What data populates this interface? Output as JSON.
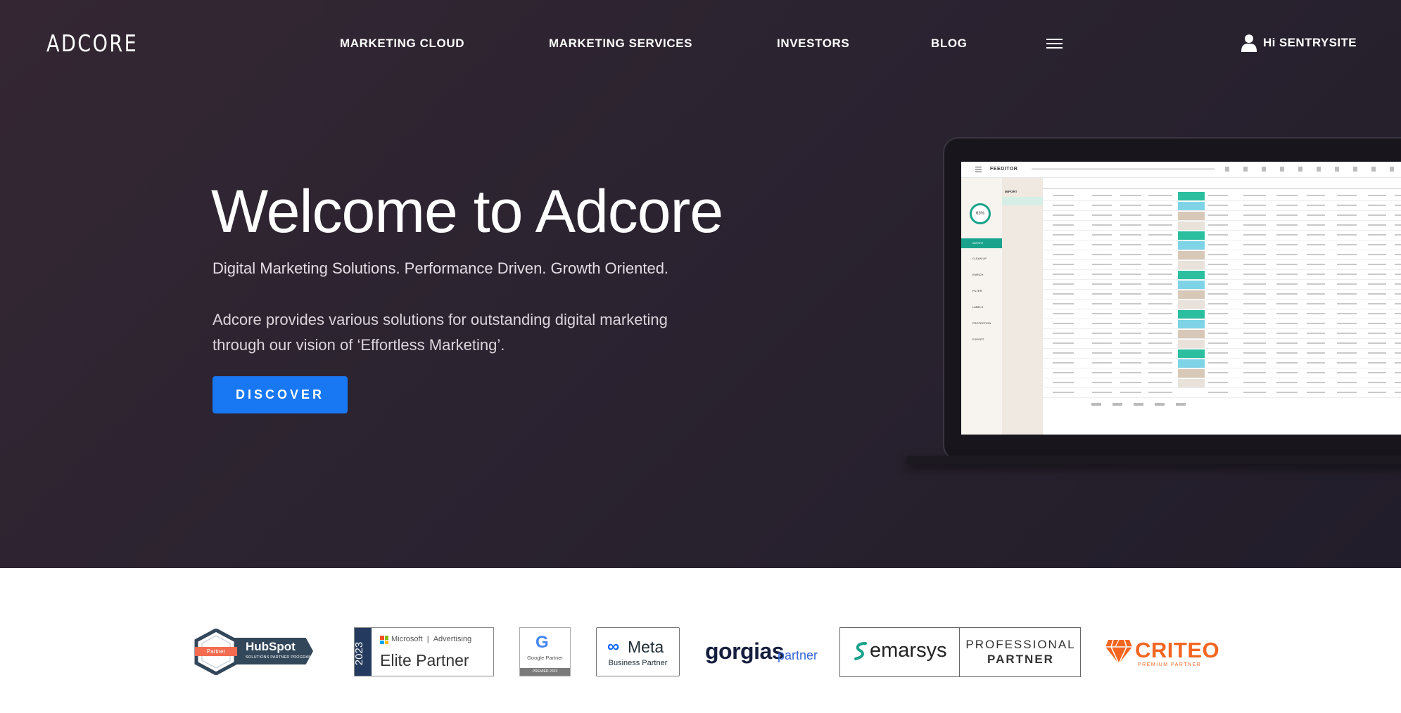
{
  "header": {
    "logo": "ADCORE",
    "nav": [
      "MARKETING CLOUD",
      "MARKETING SERVICES",
      "INVESTORS",
      "BLOG"
    ],
    "menu_icon": "hamburger-menu-icon",
    "user_icon": "user-icon",
    "user_label": "Hi SENTRYSITE"
  },
  "hero": {
    "headline": "Welcome to Adcore",
    "subheadline": "Digital Marketing Solutions. Performance Driven. Growth Oriented.",
    "description": "Adcore provides various solutions for outstanding digital marketing through our vision of ‘Effortless Marketing’.",
    "cta_label": "DISCOVER",
    "cta_color": "#1877f2"
  },
  "mockup": {
    "app_name": "FEEDITOR",
    "gauge": "63%",
    "section": "IMPORT",
    "nav_items": [
      "IMPORT",
      "CLEAN UP",
      "ENRICH",
      "FILTER",
      "LABELS",
      "PROTECTION",
      "EXPORT"
    ],
    "accent": "#1aa38c"
  },
  "partners": {
    "hubspot": {
      "tag": "Partner",
      "word": "HubSpot",
      "sub": "SOLUTIONS PARTNER PROGRAM"
    },
    "microsoft": {
      "year": "2023",
      "brand": "Microsoft",
      "category": "Advertising",
      "tier": "Elite Partner"
    },
    "google": {
      "letter": "G",
      "label": "Google Partner",
      "footer": "PREMIER 2023"
    },
    "meta": {
      "word": "Meta",
      "sub": "Business Partner"
    },
    "gorgias": {
      "word": "gorgias",
      "sub": "partner"
    },
    "emarsys": {
      "word": "emarsys",
      "line1": "PROFESSIONAL",
      "line2": "PARTNER"
    },
    "criteo": {
      "word": "CRITEO",
      "sub": "PREMIUM PARTNER"
    }
  }
}
